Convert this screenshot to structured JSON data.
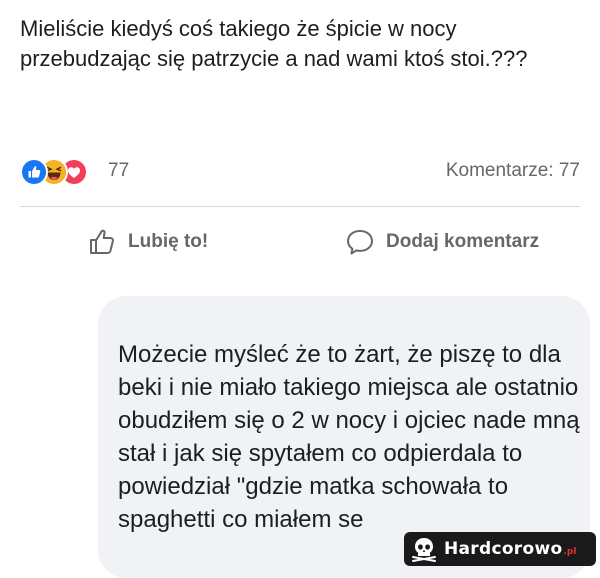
{
  "post": {
    "text": "Mieliście kiedyś coś takiego że śpicie w nocy przebudzając się patrzycie a nad wami ktoś stoi.???"
  },
  "reactions": {
    "count": "77",
    "icons": [
      "like-icon",
      "haha-icon",
      "love-icon"
    ]
  },
  "comments": {
    "count_label": "Komentarze: 77"
  },
  "actions": {
    "like_label": "Lubię to!",
    "comment_label": "Dodaj komentarz"
  },
  "comment": {
    "text": "Możecie myśleć że to żart, że piszę to dla beki i nie miało takiego miejsca ale ostatnio obudziłem się o 2 w nocy i ojciec nade mną stał i jak się spytałem co odpierdala to powiedział \"gdzie matka schowała to spaghetti co miałem se"
  },
  "watermark": {
    "name": "Hardcorowo",
    "tld": ".pl"
  },
  "colors": {
    "like": "#1877f2",
    "haha": "#f7b125",
    "love": "#f33e58",
    "muted_text": "#65676b",
    "comment_bg": "#f0f2f5"
  }
}
